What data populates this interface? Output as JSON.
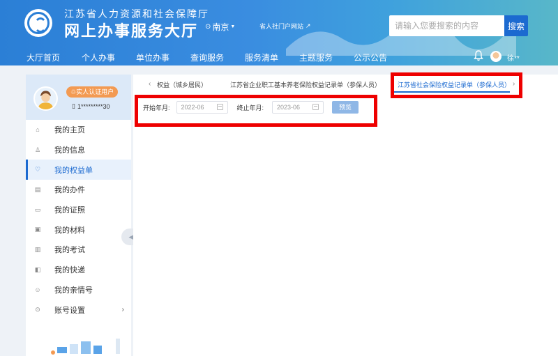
{
  "header": {
    "org_name": "江苏省人力资源和社会保障厅",
    "site_name": "网上办事服务大厅",
    "city": "南京",
    "portal_link": "省人社门户网站",
    "search_placeholder": "请输入您要搜索的内容",
    "search_button": "搜索",
    "user_name": "徐**",
    "colors": {
      "primary": "#2b7fd6",
      "accent": "#1c6ad0"
    }
  },
  "nav": {
    "items": [
      "大厅首页",
      "个人办事",
      "单位办事",
      "查询服务",
      "服务清单",
      "主题服务",
      "公示公告"
    ]
  },
  "sidebar": {
    "badge": "实人认证用户",
    "phone": "1*********30",
    "items": [
      {
        "label": "我的主页",
        "icon": "home-icon"
      },
      {
        "label": "我的信息",
        "icon": "user-icon"
      },
      {
        "label": "我的权益单",
        "icon": "heart-shield-icon"
      },
      {
        "label": "我的办件",
        "icon": "file-icon"
      },
      {
        "label": "我的证照",
        "icon": "id-card-icon"
      },
      {
        "label": "我的材料",
        "icon": "folder-icon"
      },
      {
        "label": "我的考试",
        "icon": "exam-icon"
      },
      {
        "label": "我的快递",
        "icon": "truck-icon"
      },
      {
        "label": "我的亲情号",
        "icon": "family-icon"
      },
      {
        "label": "账号设置",
        "icon": "gear-icon"
      }
    ],
    "active_index": 2
  },
  "tabs": {
    "items": [
      "权益（城乡居民）",
      "江苏省企业职工基本养老保险权益记录单（参保人员）",
      "江苏省社会保险权益记录单（参保人员）"
    ],
    "active_index": 2
  },
  "form": {
    "start_label": "开始年月:",
    "start_value": "2022-06",
    "end_label": "终止年月:",
    "end_value": "2023-06",
    "preview_button": "预览"
  }
}
